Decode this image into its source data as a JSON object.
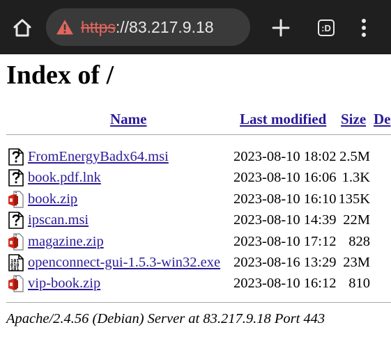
{
  "browser": {
    "url_scheme": "https",
    "url_rest": "://83.217.9.18",
    "tab_count_label": ":D"
  },
  "page": {
    "title": "Index of /",
    "columns": {
      "name": "Name",
      "last_modified": "Last modified",
      "size": "Size",
      "description": "De"
    },
    "files": [
      {
        "name": "FromEnergyBadx64.msi",
        "modified": "2023-08-10 18:02",
        "size": "2.5M",
        "icon": "unknown-file-icon"
      },
      {
        "name": "book.pdf.lnk",
        "modified": "2023-08-10 16:06",
        "size": "1.3K",
        "icon": "unknown-file-icon"
      },
      {
        "name": "book.zip",
        "modified": "2023-08-10 16:10",
        "size": "135K",
        "icon": "compressed-file-icon"
      },
      {
        "name": "ipscan.msi",
        "modified": "2023-08-10 14:39",
        "size": "22M",
        "icon": "unknown-file-icon"
      },
      {
        "name": "magazine.zip",
        "modified": "2023-08-10 17:12",
        "size": "828",
        "icon": "compressed-file-icon"
      },
      {
        "name": "openconnect-gui-1.5.3-win32.exe",
        "modified": "2023-08-16 13:29",
        "size": "23M",
        "icon": "binary-file-icon"
      },
      {
        "name": "vip-book.zip",
        "modified": "2023-08-10 16:12",
        "size": "810",
        "icon": "compressed-file-icon"
      }
    ],
    "footer": "Apache/2.4.56 (Debian) Server at 83.217.9.18 Port 443"
  }
}
